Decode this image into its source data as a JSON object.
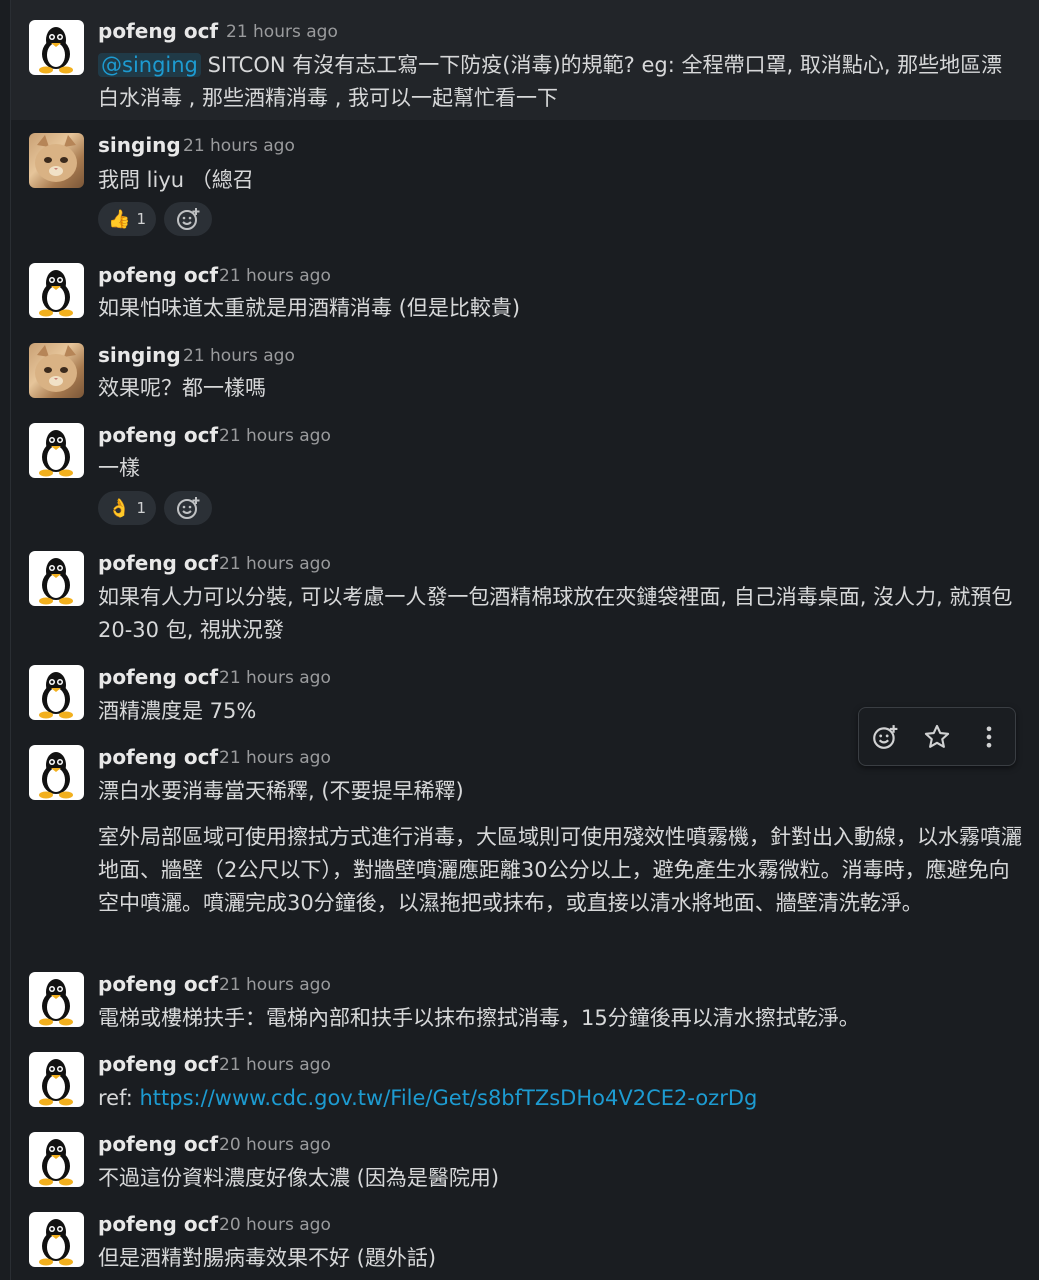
{
  "messages": [
    {
      "user": "pofeng ocf",
      "time": "21 hours ago",
      "mention": "@singing",
      "text": " SITCON 有沒有志工寫一下防疫(消毒)的規範?  eg: 全程帶口罩, 取消點心, 那些地區漂白水消毒 , 那些酒精消毒 , 我可以一起幫忙看一下"
    },
    {
      "user": "singing",
      "time": "21 hours ago",
      "text": "我問 liyu （總召",
      "reaction": {
        "emoji": "👍",
        "count": "1"
      }
    },
    {
      "user": "pofeng ocf",
      "time": "21 hours ago",
      "text": "如果怕味道太重就是用酒精消毒 (但是比較貴)"
    },
    {
      "user": "singing",
      "time": "21 hours ago",
      "text": "效果呢？都一樣嗎"
    },
    {
      "user": "pofeng ocf",
      "time": "21 hours ago",
      "text": "一樣",
      "reaction": {
        "emoji": "👌",
        "count": "1"
      }
    },
    {
      "user": "pofeng ocf",
      "time": "21 hours ago",
      "text": "如果有人力可以分裝, 可以考慮一人發一包酒精棉球放在夾鏈袋裡面, 自己消毒桌面, 沒人力, 就預包 20-30 包, 視狀況發"
    },
    {
      "user": "pofeng ocf",
      "time": "21 hours ago",
      "text": "酒精濃度是 75%"
    },
    {
      "user": "pofeng ocf",
      "time": "21 hours ago",
      "text": "漂白水要消毒當天稀釋, (不要提早稀釋)",
      "quote": "室外局部區域可使用擦拭方式進行消毒，大區域則可使用殘效性噴霧機，針對出入動線，以水霧噴灑地面、牆壁（2公尺以下），對牆壁噴灑應距離30公分以上，避免產生水霧微粒。消毒時，應避免向空中噴灑。噴灑完成30分鐘後，以濕拖把或抹布，或直接以清水將地面、牆壁清洗乾淨。"
    },
    {
      "user": "pofeng ocf",
      "time": "21 hours ago",
      "text": "電梯或樓梯扶手：電梯內部和扶手以抹布擦拭消毒，15分鐘後再以清水擦拭乾淨。"
    },
    {
      "user": "pofeng ocf",
      "time": "21 hours ago",
      "text": "ref: ",
      "link": "https://www.cdc.gov.tw/File/Get/s8bfTZsDHo4V2CE2-ozrDg"
    },
    {
      "user": "pofeng ocf",
      "time": "20 hours ago",
      "text": "不過這份資料濃度好像太濃 (因為是醫院用)"
    },
    {
      "user": "pofeng ocf",
      "time": "20 hours ago",
      "text": "但是酒精對腸病毒效果不好 (題外話)"
    }
  ],
  "toolbar": {
    "icons": [
      "add-reaction-icon",
      "star-icon",
      "more-actions-icon"
    ]
  }
}
